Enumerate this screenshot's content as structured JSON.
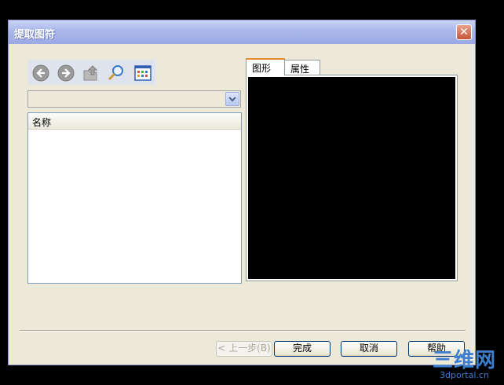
{
  "window": {
    "title": "提取图符",
    "close_symbol": "✕"
  },
  "toolbar": {
    "icons": [
      "back-arrow-icon",
      "forward-arrow-icon",
      "up-folder-icon",
      "search-icon",
      "view-grid-icon"
    ]
  },
  "combo": {
    "value": ""
  },
  "list": {
    "column_header": "名称",
    "rows": []
  },
  "tabs": [
    {
      "label": "图形",
      "active": true
    },
    {
      "label": "属性",
      "active": false
    }
  ],
  "buttons": {
    "back_label": "< 上一步(B)",
    "finish_label": "完成",
    "cancel_label": "取消",
    "help_label": "帮助"
  },
  "watermark": {
    "big": "三维网",
    "small": "3dportal.cn"
  },
  "colors": {
    "desktop": "#000000",
    "dialog_face": "#ece9d8",
    "titlebar": "#a9b7ea",
    "tab_accent": "#e68b2c",
    "preview_bg": "#000000"
  }
}
